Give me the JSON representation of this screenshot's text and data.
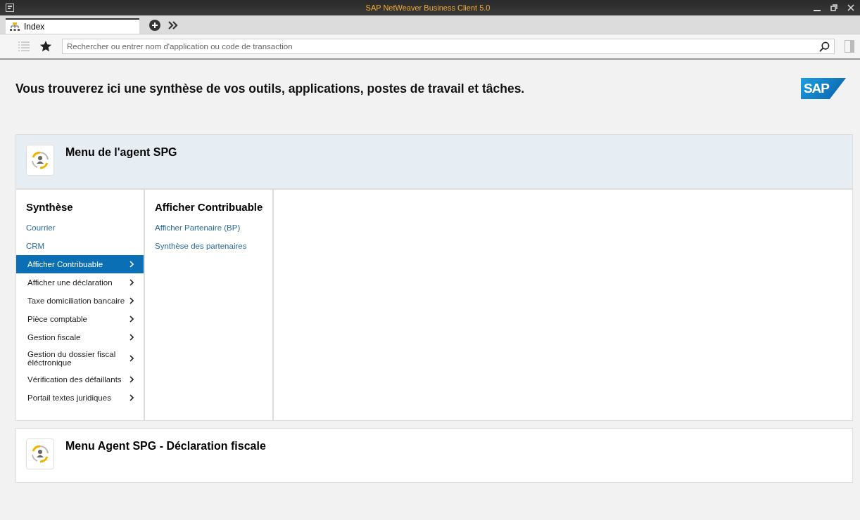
{
  "window": {
    "title": "SAP NetWeaver Business Client 5.0"
  },
  "tabs": [
    {
      "label": "Index",
      "selected": true
    }
  ],
  "search": {
    "placeholder": "Rechercher ou entrer nom d'application ou code de transaction"
  },
  "heading": "Vous trouverez ici une synthèse de vos outils, applications, postes de travail et tâches.",
  "logo": "SAP",
  "cards": [
    {
      "title": "Menu de l'agent SPG",
      "expanded": true,
      "column_title": "Synthèse",
      "items": [
        {
          "label": "Courrier",
          "kind": "link",
          "selected": false
        },
        {
          "label": "CRM",
          "kind": "link",
          "selected": false
        },
        {
          "label": "Afficher Contribuable",
          "kind": "group",
          "selected": true
        },
        {
          "label": "Afficher une déclaration",
          "kind": "group",
          "selected": false
        },
        {
          "label": "Taxe domiciliation bancaire",
          "kind": "group",
          "selected": false
        },
        {
          "label": "Pièce comptable",
          "kind": "group",
          "selected": false
        },
        {
          "label": "Gestion fiscale",
          "kind": "group",
          "selected": false
        },
        {
          "label": "Gestion du dossier fiscal éléctronique",
          "kind": "group",
          "selected": false
        },
        {
          "label": "Vérification des défaillants",
          "kind": "group",
          "selected": false
        },
        {
          "label": "Portail textes juridiques",
          "kind": "group",
          "selected": false
        }
      ],
      "sub_title": "Afficher Contribuable",
      "sub_items": [
        "Afficher Partenaire (BP)",
        "Synthèse des partenaires"
      ]
    },
    {
      "title": "Menu Agent SPG - Déclaration fiscale",
      "expanded": false
    }
  ]
}
